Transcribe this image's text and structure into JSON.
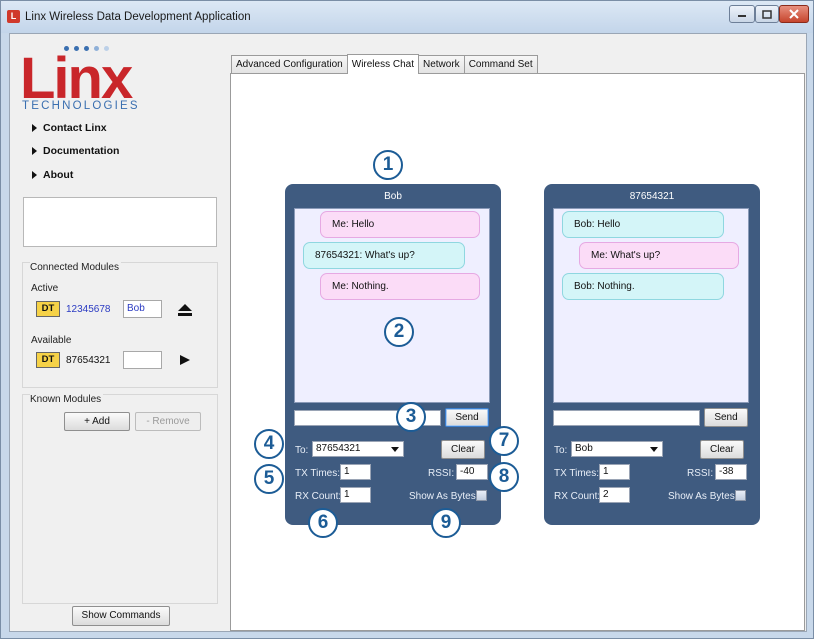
{
  "window": {
    "title": "Linx Wireless Data Development Application",
    "app_icon": "L"
  },
  "sidebar": {
    "logo": {
      "text": "Linx",
      "subtitle": "TECHNOLOGIES",
      "color": "#c9262a"
    },
    "nav": [
      {
        "label": "Contact Linx"
      },
      {
        "label": "Documentation"
      },
      {
        "label": "About"
      }
    ],
    "connected_modules": {
      "title": "Connected Modules",
      "active_label": "Active",
      "active": {
        "badge": "DT",
        "id": "12345678",
        "name": "Bob"
      },
      "available_label": "Available",
      "available": {
        "badge": "DT",
        "id": "87654321",
        "name": ""
      }
    },
    "known_modules": {
      "title": "Known Modules",
      "add_label": "+ Add",
      "remove_label": "- Remove"
    },
    "show_commands_label": "Show Commands"
  },
  "tabs": [
    {
      "label": "Advanced Configuration",
      "active": false
    },
    {
      "label": "Wireless Chat",
      "active": true
    },
    {
      "label": "Network",
      "active": false
    },
    {
      "label": "Command Set",
      "active": false
    }
  ],
  "chats": [
    {
      "title": "Bob",
      "messages": [
        {
          "text": "Me: Hello",
          "from": "me"
        },
        {
          "text": "87654321: What's up?",
          "from": "them"
        },
        {
          "text": "Me: Nothing.",
          "from": "me"
        }
      ],
      "send_label": "Send",
      "to_label": "To:",
      "to_value": "87654321",
      "clear_label": "Clear",
      "tx_label": "TX Times:",
      "tx_value": "1",
      "rssi_label": "RSSI:",
      "rssi_value": "-40",
      "rx_label": "RX Count:",
      "rx_value": "1",
      "bytes_label": "Show As Bytes"
    },
    {
      "title": "87654321",
      "messages": [
        {
          "text": "Bob: Hello",
          "from": "them"
        },
        {
          "text": "Me: What's up?",
          "from": "me"
        },
        {
          "text": "Bob: Nothing.",
          "from": "them"
        }
      ],
      "send_label": "Send",
      "to_label": "To:",
      "to_value": "Bob",
      "clear_label": "Clear",
      "tx_label": "TX Times:",
      "tx_value": "1",
      "rssi_label": "RSSI:",
      "rssi_value": "-38",
      "rx_label": "RX Count:",
      "rx_value": "2",
      "bytes_label": "Show As Bytes"
    }
  ],
  "callouts": [
    "1",
    "2",
    "3",
    "4",
    "5",
    "6",
    "7",
    "8",
    "9"
  ],
  "colors": {
    "chat_panel": "#3f5b80",
    "bubble_me": "#fbdcf7",
    "bubble_them": "#d4f5f8",
    "callout": "#1c5c96"
  }
}
